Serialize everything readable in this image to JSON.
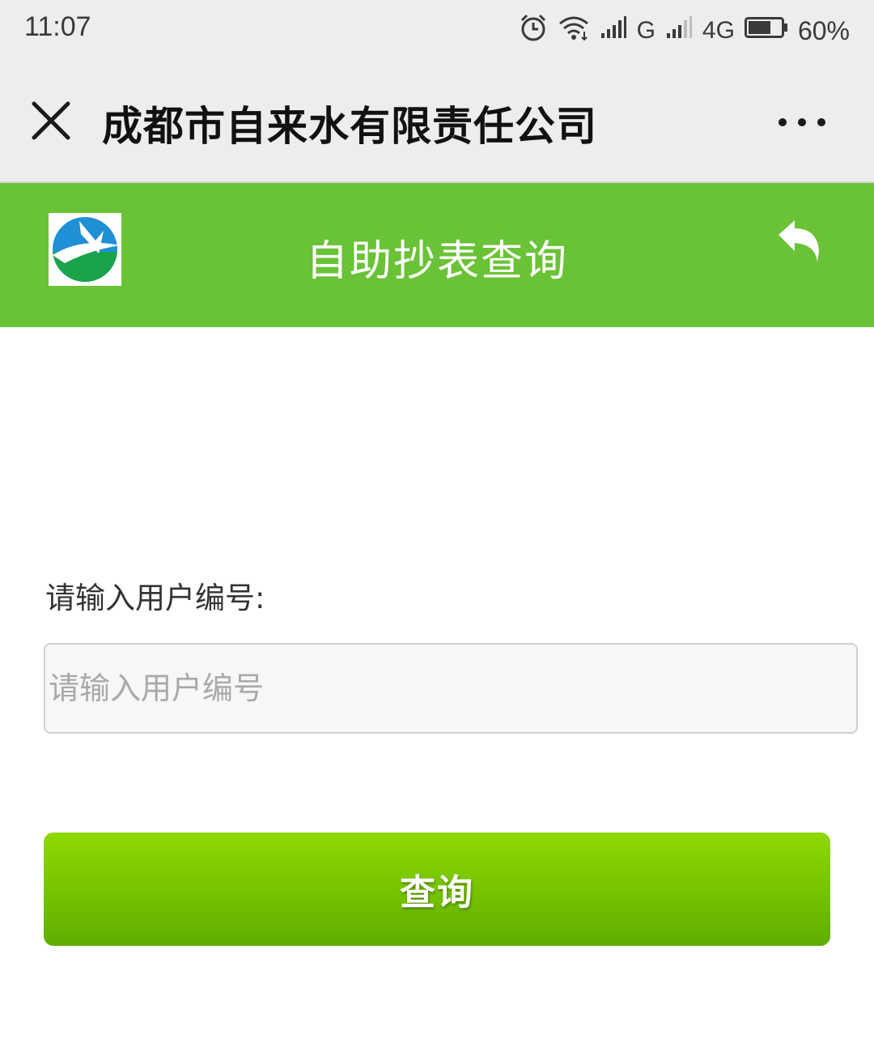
{
  "status_bar": {
    "time": "11:07",
    "network_1": "G",
    "network_2": "4G",
    "battery": "60%",
    "icons": [
      "alarm-icon",
      "wifi-icon",
      "signal-icon",
      "signal-icon",
      "battery-icon"
    ]
  },
  "header": {
    "title": "成都市自来水有限责任公司",
    "close_icon": "close-icon",
    "more_icon": "more-dots-icon",
    "background": "#ededed"
  },
  "app_bar": {
    "title": "自助抄表查询",
    "back_icon": "reply-back-icon",
    "logo": "company-logo",
    "background": "#6ac237"
  },
  "form": {
    "label": "请输入用户编号:",
    "input_value": "",
    "input_placeholder": "请输入用户编号",
    "submit_label": "查询",
    "button_color": "#77c400"
  }
}
